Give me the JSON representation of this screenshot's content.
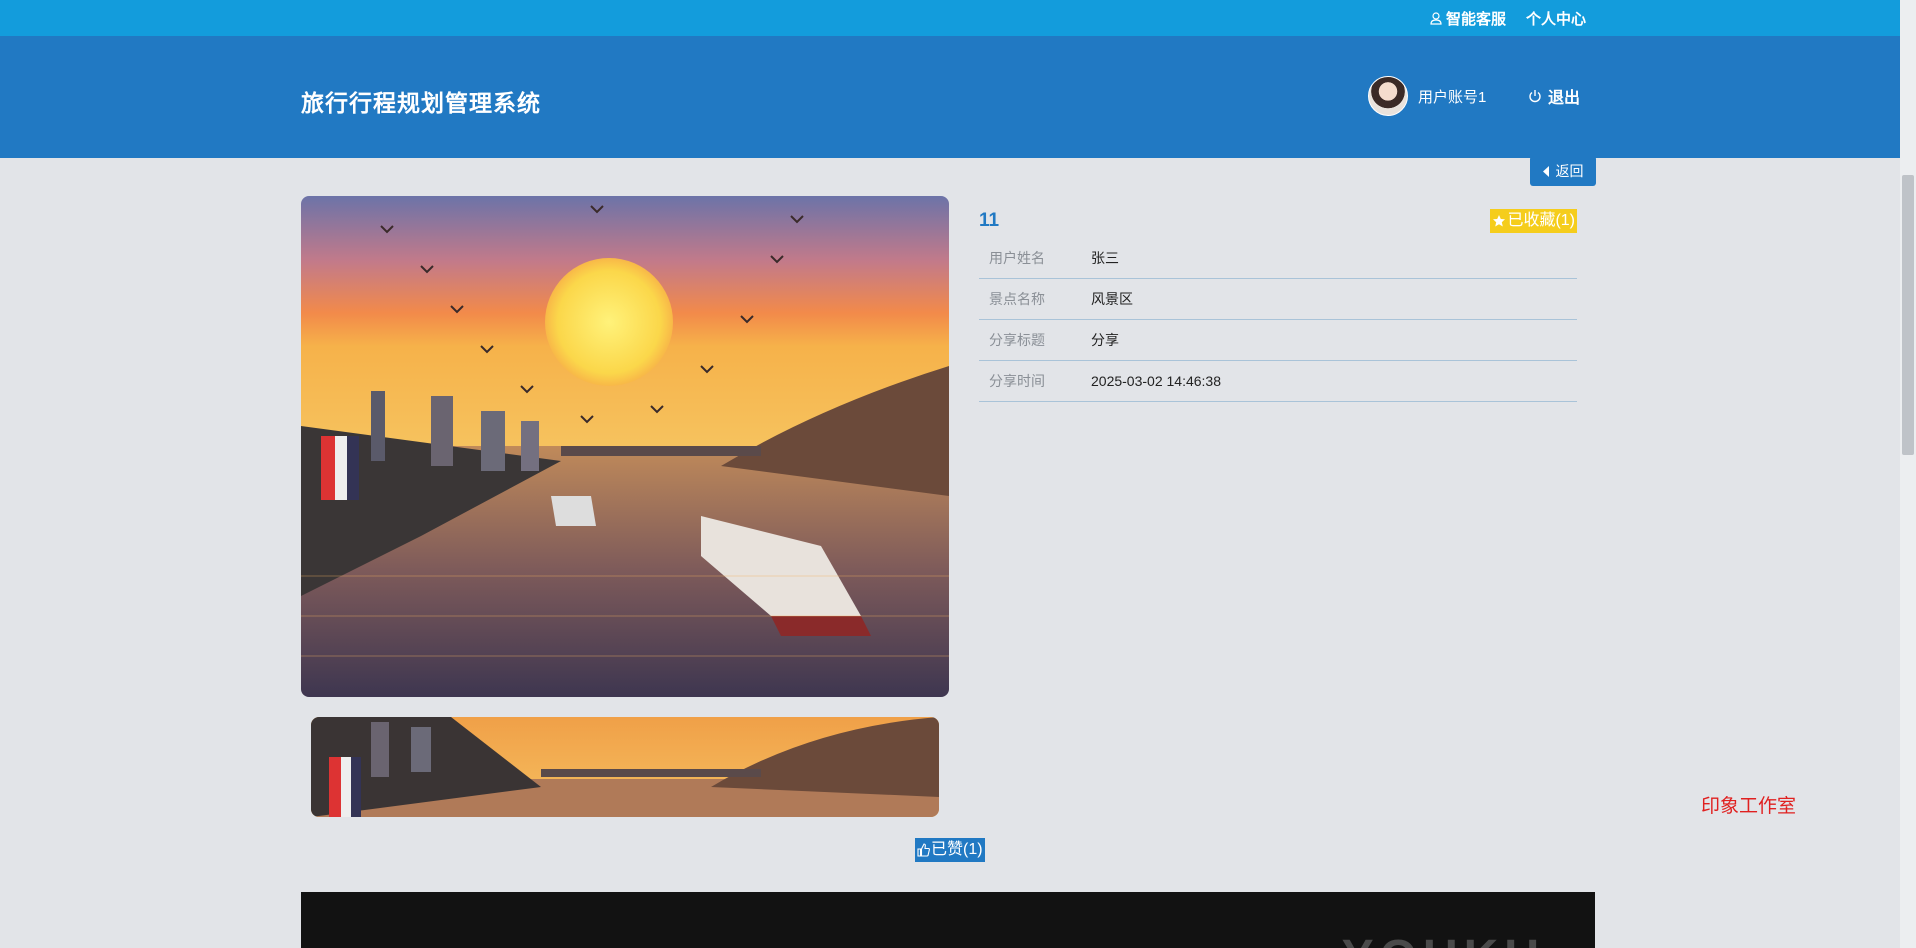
{
  "topbar": {
    "customer_service": "智能客服",
    "personal_center": "个人中心"
  },
  "header": {
    "title": "旅行行程规划管理系统",
    "username": "用户账号1",
    "logout": "退出"
  },
  "actions": {
    "back": "返回",
    "favorited": "已收藏(1)",
    "liked": "已赞(1)"
  },
  "detail": {
    "title": "11",
    "rows": [
      {
        "label": "用户姓名",
        "value": "张三"
      },
      {
        "label": "景点名称",
        "value": "风景区"
      },
      {
        "label": "分享标题",
        "value": "分享"
      },
      {
        "label": "分享时间",
        "value": "2025-03-02 14:46:38"
      }
    ]
  },
  "footer": {
    "studio": "印象工作室",
    "video_watermark": "YOUKU"
  },
  "colors": {
    "topbar": "#139cdc",
    "header": "#2179c3",
    "favorite": "#f5cd1c",
    "studio_text": "#e02020"
  },
  "icons": {
    "customer_service": "user-outline-icon",
    "logout": "power-icon",
    "back": "caret-left-icon",
    "favorite": "star-icon",
    "like": "thumb-up-icon"
  }
}
